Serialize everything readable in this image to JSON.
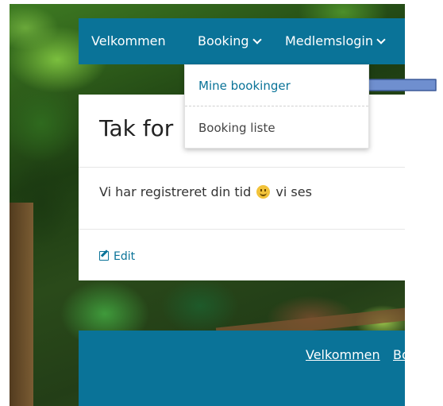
{
  "nav": {
    "welcome": "Velkommen",
    "booking": "Booking",
    "member_login": "Medlemslogin"
  },
  "dropdown": {
    "items": [
      {
        "label": "Mine bookinger"
      },
      {
        "label": "Booking liste"
      }
    ]
  },
  "content": {
    "title": "Tak for",
    "message_before": "Vi har registreret din tid",
    "message_after": "vi ses",
    "edit_label": "Edit"
  },
  "footer": {
    "links": [
      "Velkommen",
      "Bo"
    ]
  },
  "colors": {
    "primary": "#0a7398",
    "annotation_arrow": "#6f8fcf"
  },
  "icons": [
    "chevron-down-icon",
    "smiley-icon",
    "edit-icon",
    "arrow-left-icon"
  ]
}
